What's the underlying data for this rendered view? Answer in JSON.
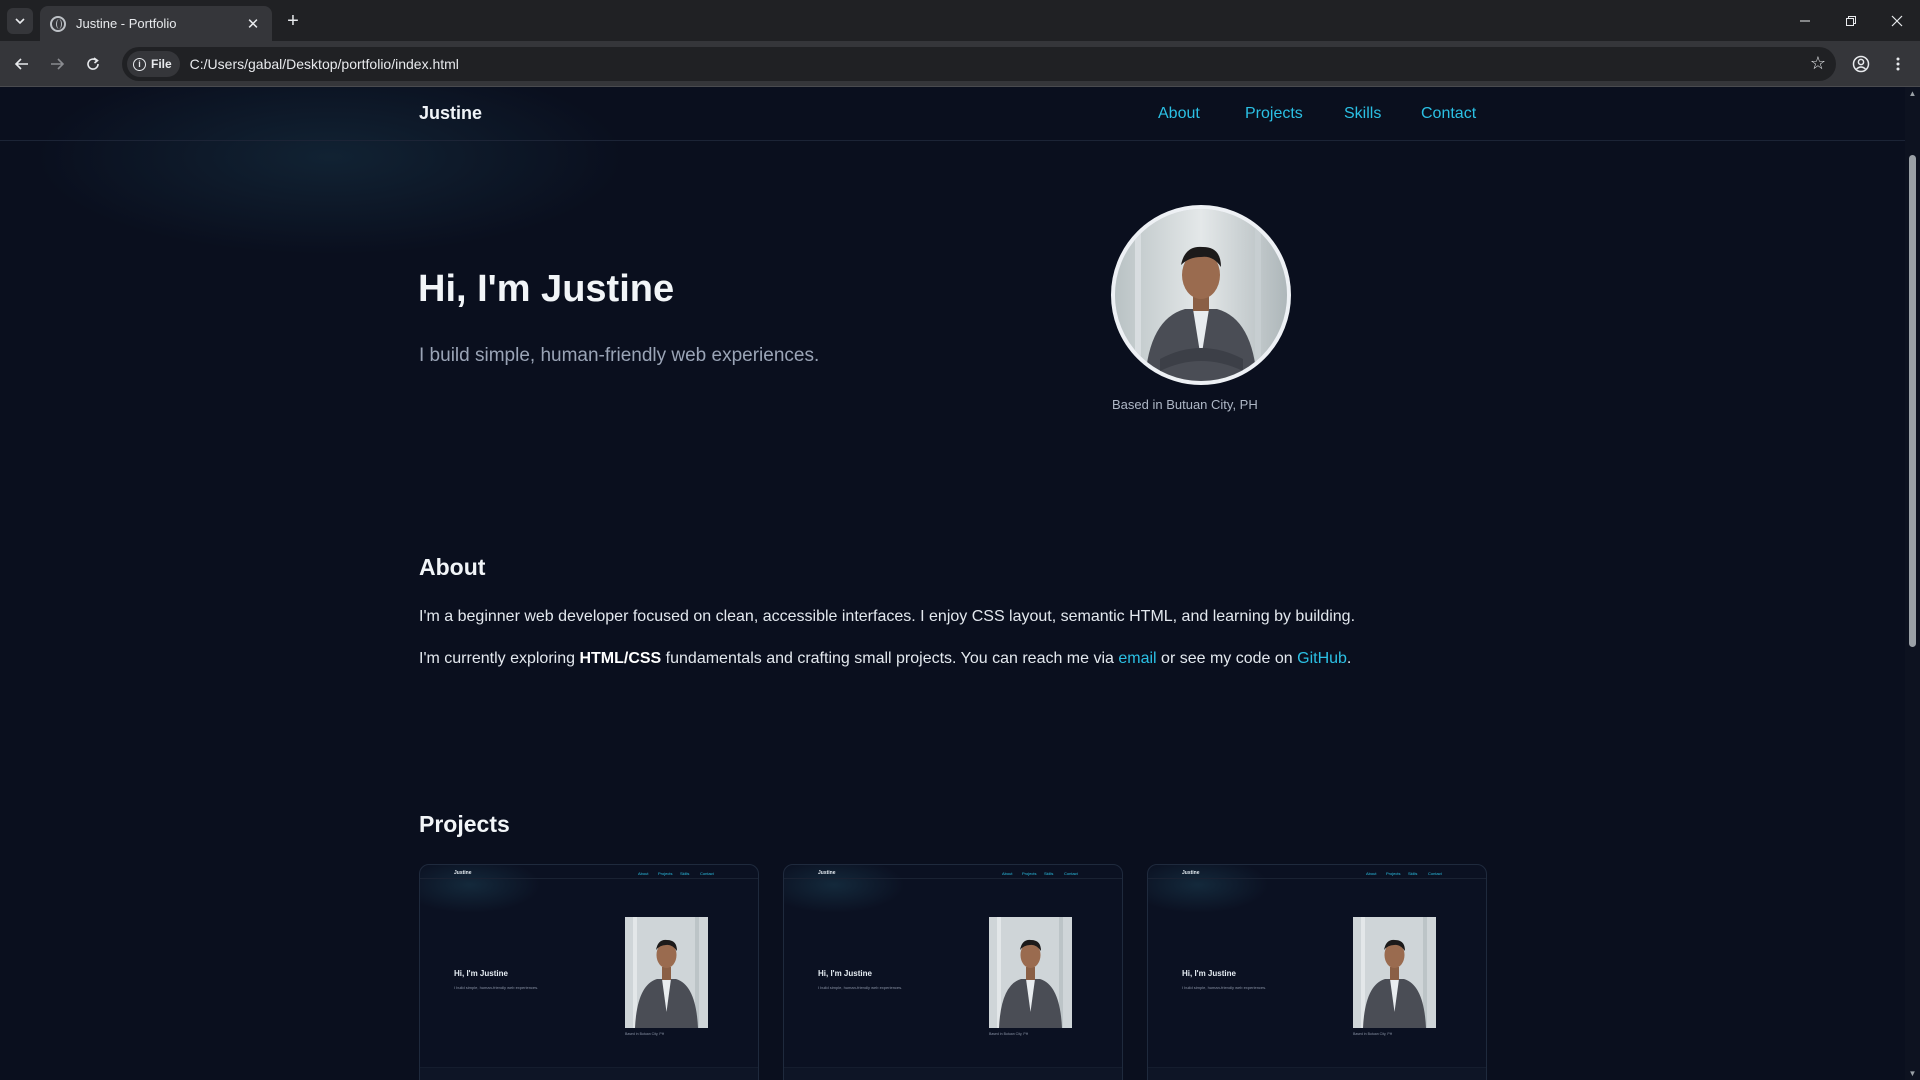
{
  "browser": {
    "tab_title": "Justine - Portfolio",
    "url_chip": "File",
    "url": "C:/Users/gabal/Desktop/portfolio/index.html"
  },
  "site": {
    "brand": "Justine",
    "nav": [
      {
        "label": "About"
      },
      {
        "label": "Projects"
      },
      {
        "label": "Skills"
      },
      {
        "label": "Contact"
      }
    ]
  },
  "hero": {
    "title": "Hi, I'm Justine",
    "subtitle": "I build simple, human-friendly web experiences.",
    "caption": "Based in Butuan City, PH"
  },
  "about": {
    "title": "About",
    "p1": "I'm a beginner web developer focused on clean, accessible interfaces. I enjoy CSS layout, semantic HTML, and learning by building.",
    "p2_pre": "I'm currently exploring ",
    "p2_bold": "HTML/CSS",
    "p2_mid": " fundamentals and crafting small projects. You can reach me via ",
    "p2_link1": "email",
    "p2_mid2": " or see my code on ",
    "p2_link2": "GitHub",
    "p2_end": "."
  },
  "projects": {
    "title": "Projects",
    "cards": [
      {
        "brand": "Justine",
        "title": "Hi, I'm Justine",
        "sub": "I build simple, human-friendly web experiences.",
        "caption": "Based in Butuan City, PH",
        "nav": [
          "About",
          "Projects",
          "Skills",
          "Contact"
        ]
      },
      {
        "brand": "Justine",
        "title": "Hi, I'm Justine",
        "sub": "I build simple, human-friendly web experiences.",
        "caption": "Based in Butuan City, PH",
        "nav": [
          "About",
          "Projects",
          "Skills",
          "Contact"
        ]
      },
      {
        "brand": "Justine",
        "title": "Hi, I'm Justine",
        "sub": "I build simple, human-friendly web experiences.",
        "caption": "Based in Butuan City, PH",
        "nav": [
          "About",
          "Projects",
          "Skills",
          "Contact"
        ]
      }
    ]
  },
  "colors": {
    "background": "#0a0f1e",
    "accent": "#2bc0e4",
    "text": "#e6edf3"
  }
}
